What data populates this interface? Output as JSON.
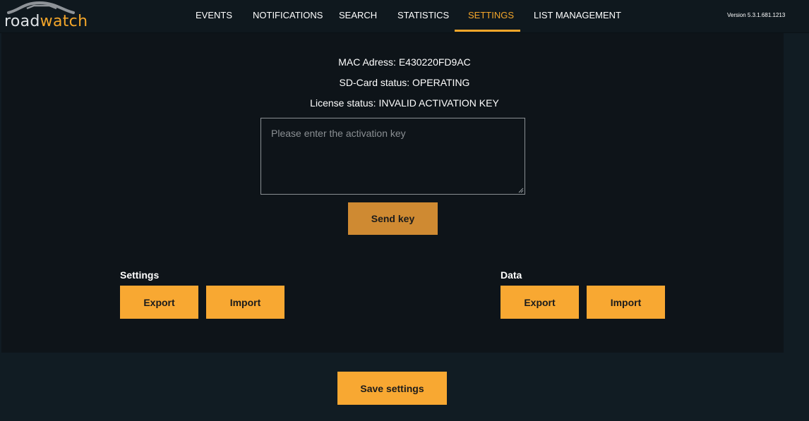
{
  "app": {
    "logo_part1": "road",
    "logo_part2": "watch"
  },
  "nav": {
    "items": [
      {
        "label": "EVENTS"
      },
      {
        "label": "NOTIFICATIONS"
      },
      {
        "label": "SEARCH"
      },
      {
        "label": "STATISTICS"
      },
      {
        "label": "SETTINGS",
        "active": true
      },
      {
        "label": "LIST MANAGEMENT"
      }
    ]
  },
  "version": "Version 5.3.1.681.1213",
  "device": {
    "mac": "MAC Adress: E430220FD9AC",
    "sd_card": "SD-Card status: OPERATING",
    "license": "License status: INVALID ACTIVATION KEY"
  },
  "activation": {
    "placeholder": "Please enter the activation key",
    "value": "",
    "send_label": "Send key"
  },
  "settings_section": {
    "title": "Settings",
    "export_label": "Export",
    "import_label": "Import"
  },
  "data_section": {
    "title": "Data",
    "export_label": "Export",
    "import_label": "Import"
  },
  "footer": {
    "save_label": "Save settings"
  },
  "colors": {
    "accent": "#f8a832",
    "background": "#111c23",
    "panel": "#0e1419"
  }
}
